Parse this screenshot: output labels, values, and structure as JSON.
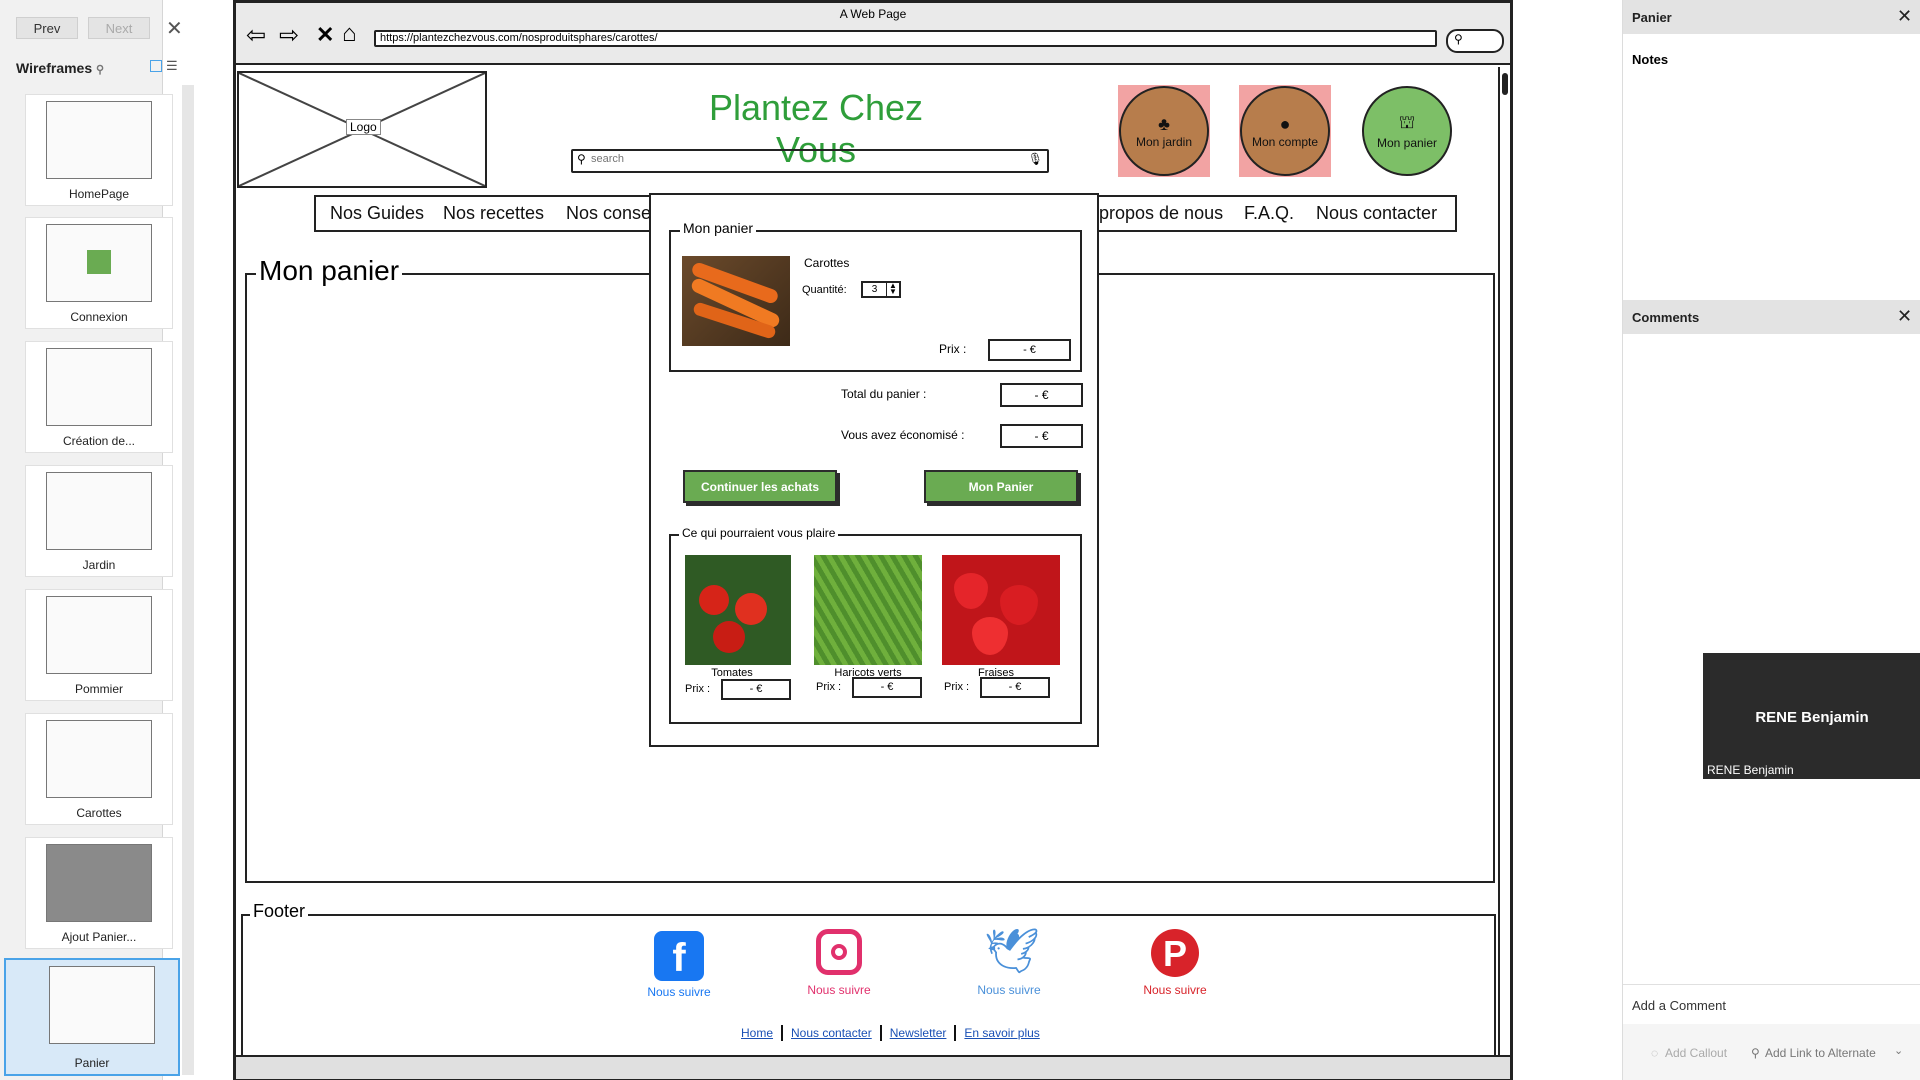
{
  "left_panel": {
    "prev_label": "Prev",
    "next_label": "Next",
    "title": "Wireframes",
    "pages": [
      {
        "label": "HomePage"
      },
      {
        "label": "Connexion"
      },
      {
        "label": "Création de..."
      },
      {
        "label": "Jardin"
      },
      {
        "label": "Pommier"
      },
      {
        "label": "Carottes"
      },
      {
        "label": "Ajout Panier..."
      },
      {
        "label": "Panier"
      }
    ]
  },
  "browser": {
    "title": "A Web Page",
    "url": "https://plantezchezvous.com/nosproduitsphares/carottes/"
  },
  "site": {
    "logo_label": "Logo",
    "title": "Plantez Chez Vous",
    "search_placeholder": "search",
    "buttons": [
      {
        "label": "Mon jardin",
        "icon": "tree-icon",
        "color": "#b77d4c"
      },
      {
        "label": "Mon compte",
        "icon": "user-icon",
        "color": "#b77d4c"
      },
      {
        "label": "Mon panier",
        "icon": "basket-icon",
        "color": "#7dbf67"
      }
    ],
    "nav": [
      "Nos Guides",
      "Nos recettes",
      "Nos conse",
      "propos de nous",
      "F.A.Q.",
      "Nous contacter"
    ],
    "main_heading": "Mon panier",
    "footer_title": "Footer",
    "social": [
      {
        "label": "Nous suivre",
        "icon": "facebook-icon",
        "color": "#1877f2"
      },
      {
        "label": "Nous suivre",
        "icon": "instagram-icon",
        "color": "#e1306c"
      },
      {
        "label": "Nous suivre",
        "icon": "twitter-icon",
        "color": "#4a90d9"
      },
      {
        "label": "Nous suivre",
        "icon": "pinterest-icon",
        "color": "#d8232a"
      }
    ],
    "footer_links": [
      "Home",
      "Nous contacter",
      "Newsletter",
      "En savoir plus"
    ]
  },
  "popup": {
    "title": "Mon panier",
    "product_name": "Carottes",
    "quantity_label": "Quantité:",
    "quantity_value": "3",
    "price_label": "Prix :",
    "price_value": "- €",
    "total_label": "Total du panier :",
    "total_value": "- €",
    "savings_label": "Vous avez économisé :",
    "savings_value": "- €",
    "continue_label": "Continuer les achats",
    "cart_label": "Mon Panier",
    "suggest_title": "Ce qui pourraient vous plaire",
    "suggestions": [
      {
        "name": "Tomates",
        "price_label": "Prix :",
        "price": "- €"
      },
      {
        "name": "Haricots verts",
        "price_label": "Prix :",
        "price": "- €"
      },
      {
        "name": "Fraises",
        "price_label": "Prix :",
        "price": "- €"
      }
    ]
  },
  "right_panel": {
    "panel_title": "Panier",
    "notes_label": "Notes",
    "comments_title": "Comments",
    "user_tile_name": "RENE Benjamin",
    "user_tile_caption": "RENE Benjamin",
    "add_comment": "Add a Comment",
    "add_callout": "Add Callout",
    "add_link": "Add Link to Alternate"
  }
}
